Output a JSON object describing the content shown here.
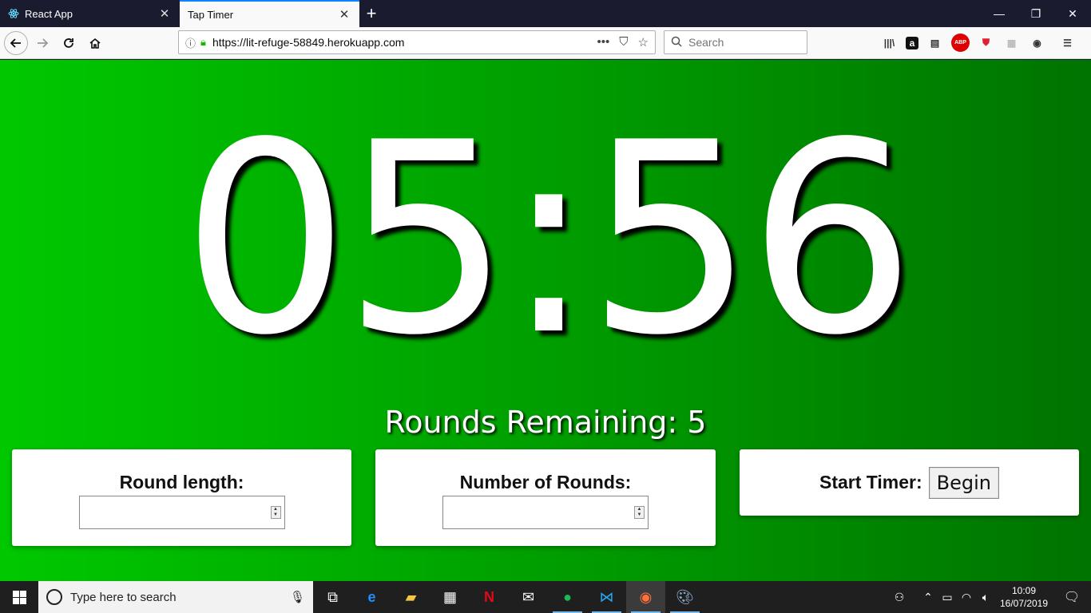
{
  "browser": {
    "tabs": [
      {
        "title": "React App",
        "active": false
      },
      {
        "title": "Tap Timer",
        "active": true
      }
    ],
    "new_tab_symbol": "+",
    "url": "https://lit-refuge-58849.herokuapp.com",
    "search_placeholder": "Search",
    "window_controls": {
      "minimize": "—",
      "restore": "❐",
      "close": "✕"
    },
    "toolbar_icons": [
      "library-icon",
      "amazon-icon",
      "reader-icon",
      "adblock-icon",
      "brave-shield-icon",
      "extension-icon",
      "account-icon",
      "menu-icon"
    ],
    "abp_text": "ABP",
    "amazon_text": "a"
  },
  "page": {
    "background_gradient": [
      "#00c800",
      "#009a00",
      "#007400"
    ],
    "timer_display": "05:56",
    "rounds_remaining_label": "Rounds Remaining: 5",
    "round_length_label": "Round length:",
    "round_length_value": "",
    "number_of_rounds_label": "Number of Rounds:",
    "number_of_rounds_value": "",
    "start_timer_label": "Start Timer:",
    "begin_button": "Begin"
  },
  "taskbar": {
    "search_placeholder": "Type here to search",
    "apps": [
      "task-view-icon",
      "edge-icon",
      "file-explorer-icon",
      "store-icon",
      "netflix-icon",
      "mail-icon",
      "spotify-icon",
      "vscode-icon",
      "firefox-icon",
      "paint-icon"
    ],
    "time": "10:09",
    "date": "16/07/2019"
  }
}
